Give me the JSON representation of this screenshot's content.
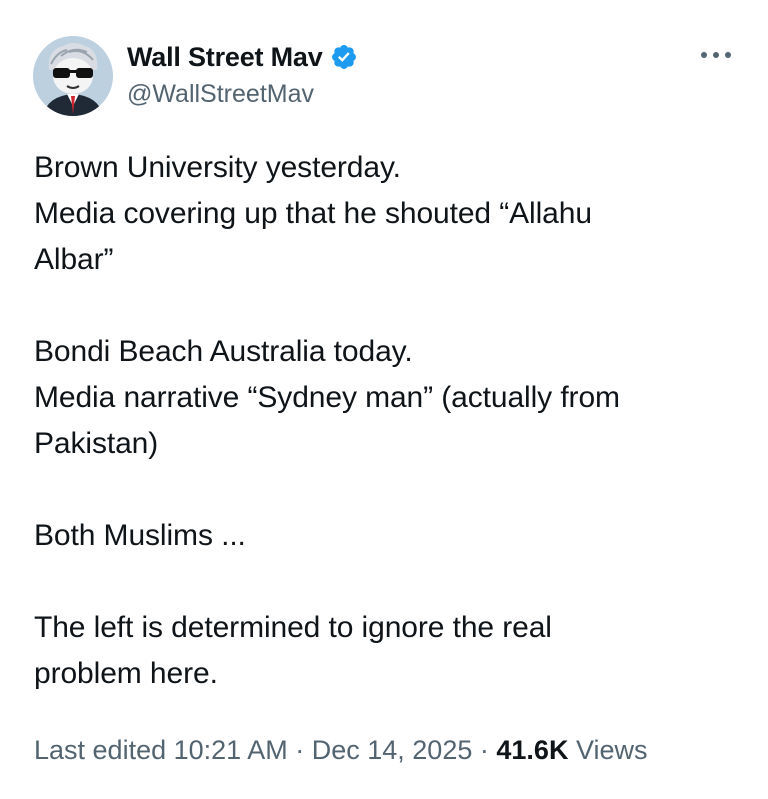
{
  "author": {
    "display_name": "Wall Street Mav",
    "handle": "@WallStreetMav",
    "verified_icon": "verified-badge-icon",
    "avatar_icon": "cartoon-avatar-sunglasses"
  },
  "more_icon": "more-horizontal-icon",
  "tweet": {
    "paragraphs": [
      "Brown University yesterday.\nMedia covering up that he shouted “Allahu\nAlbar”",
      "Bondi Beach Australia today.\nMedia narrative “Sydney man” (actually from\nPakistan)",
      "Both Muslims ...",
      "The left is determined to ignore the real\nproblem here."
    ]
  },
  "meta": {
    "edited_label": "Last edited",
    "time": "10:21 AM",
    "separator": "·",
    "date": "Dec 14, 2025",
    "views_count": "41.6K",
    "views_label": "Views"
  },
  "colors": {
    "text_primary": "#0f1419",
    "text_secondary": "#536471",
    "verified_blue": "#1d9bf0"
  }
}
